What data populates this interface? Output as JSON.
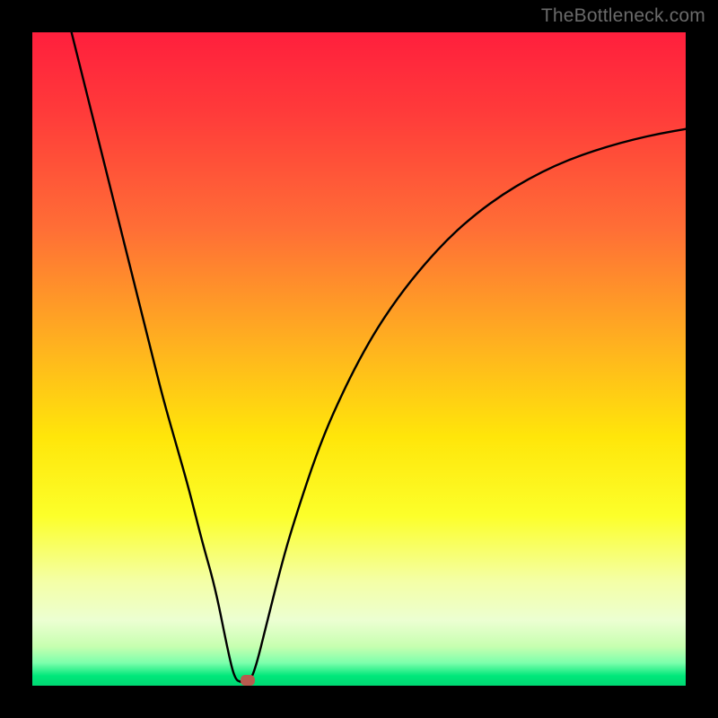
{
  "watermark": "TheBottleneck.com",
  "chart_data": {
    "type": "line",
    "title": "",
    "xlabel": "",
    "ylabel": "",
    "xlim": [
      0,
      100
    ],
    "ylim": [
      0,
      100
    ],
    "grid": false,
    "series": [
      {
        "name": "bottleneck-curve",
        "x": [
          6,
          8,
          10,
          12,
          14,
          16,
          18,
          20,
          22,
          24,
          26,
          28,
          30,
          31,
          32,
          33,
          34,
          36,
          38,
          40,
          44,
          48,
          52,
          56,
          60,
          64,
          68,
          72,
          76,
          80,
          84,
          88,
          92,
          96,
          100
        ],
        "values": [
          100,
          92,
          84,
          76,
          68,
          60,
          52,
          44,
          37,
          30,
          22,
          15,
          5,
          1,
          0.5,
          0.5,
          2,
          10,
          18,
          25,
          37,
          46,
          53.5,
          59.5,
          64.5,
          68.8,
          72.3,
          75.2,
          77.6,
          79.6,
          81.2,
          82.5,
          83.6,
          84.5,
          85.2
        ],
        "color": "#000000"
      }
    ],
    "marker": {
      "x": 33,
      "y": 0.8,
      "color": "#b85b4f"
    },
    "gradient_stops": [
      {
        "offset": 0,
        "color": "#ff1f3d"
      },
      {
        "offset": 0.12,
        "color": "#ff3a3a"
      },
      {
        "offset": 0.3,
        "color": "#ff6e36"
      },
      {
        "offset": 0.48,
        "color": "#ffb21f"
      },
      {
        "offset": 0.62,
        "color": "#ffe60a"
      },
      {
        "offset": 0.74,
        "color": "#fcff2a"
      },
      {
        "offset": 0.84,
        "color": "#f4ffa6"
      },
      {
        "offset": 0.9,
        "color": "#ecffd2"
      },
      {
        "offset": 0.94,
        "color": "#c7ffb0"
      },
      {
        "offset": 0.965,
        "color": "#7dffac"
      },
      {
        "offset": 0.985,
        "color": "#00e77a"
      },
      {
        "offset": 1.0,
        "color": "#00d873"
      }
    ]
  }
}
